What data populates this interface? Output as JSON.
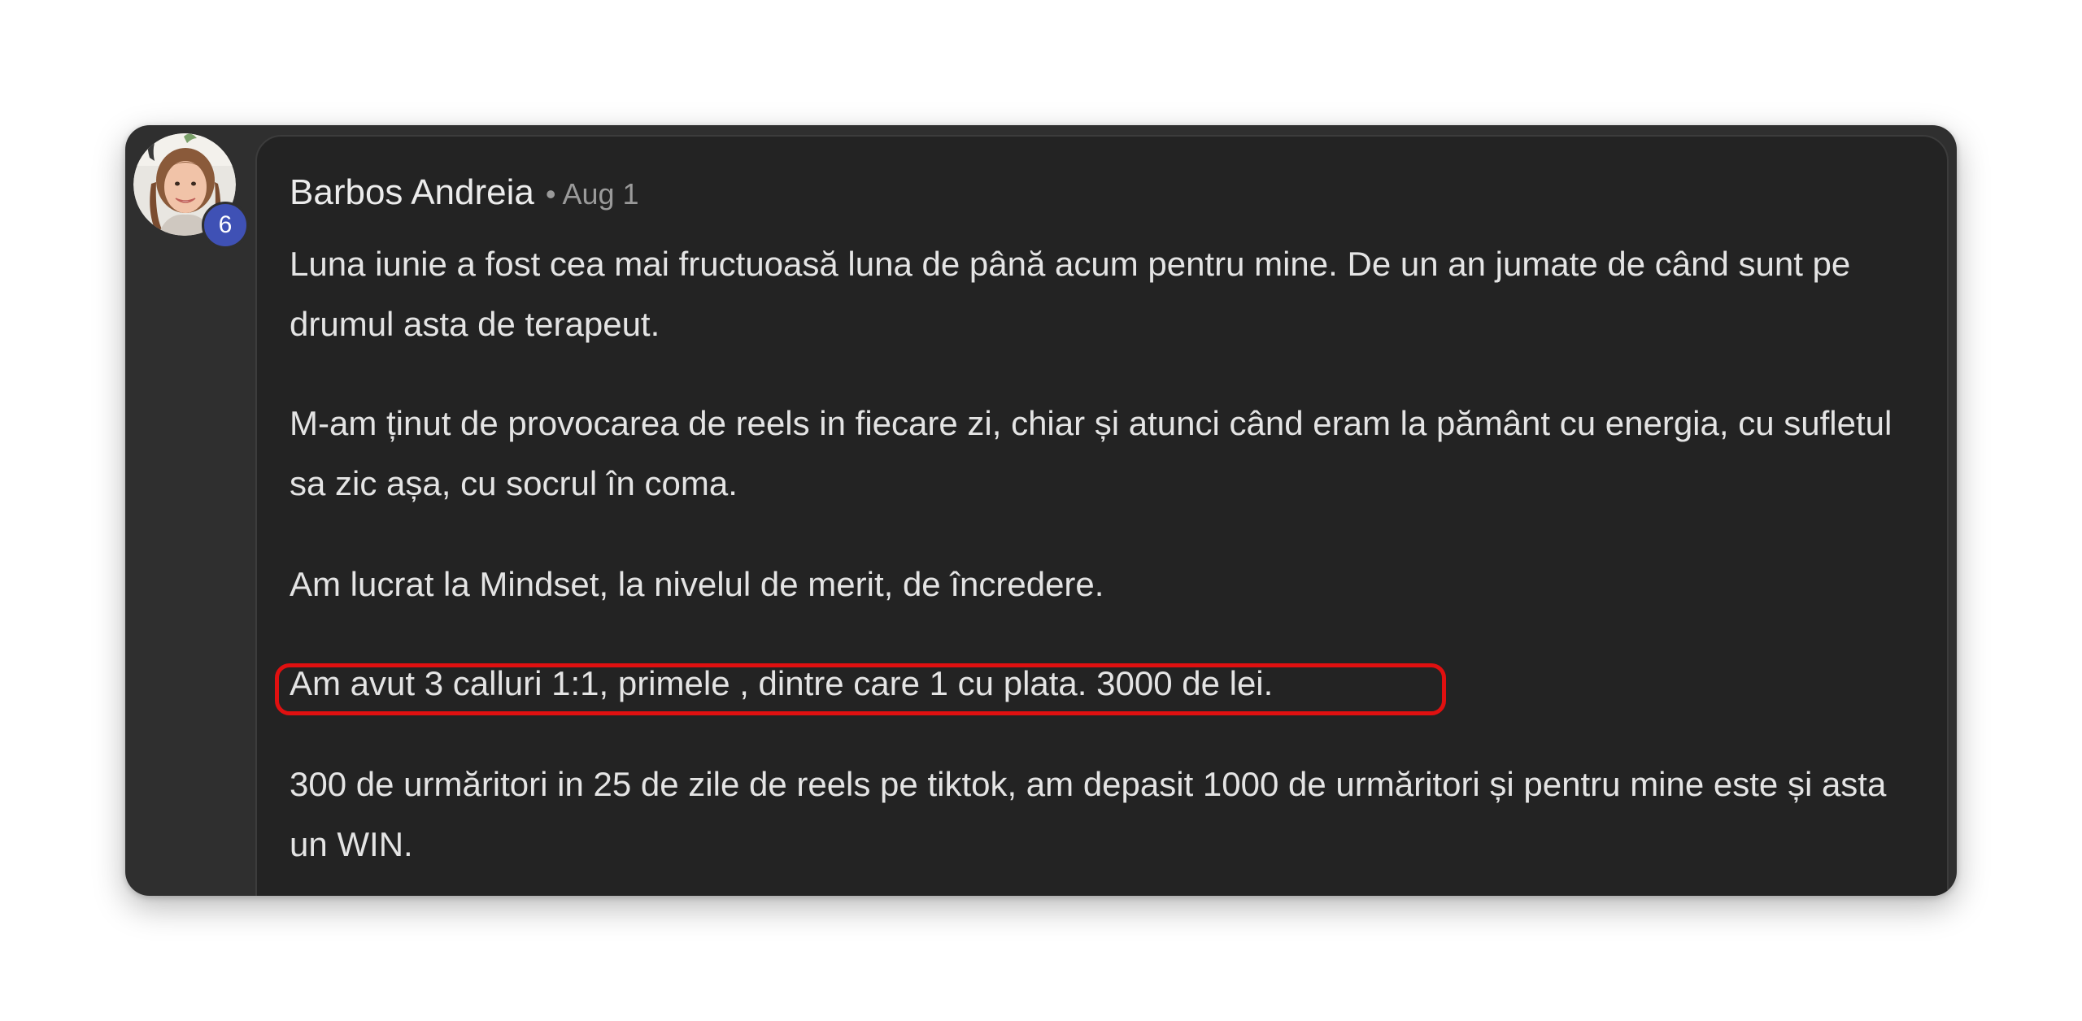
{
  "comment": {
    "author": "Barbos Andreia",
    "separator": "•",
    "date": "Aug 1",
    "level": "6",
    "paragraphs": [
      "Luna iunie a fost cea mai fructuoasă luna de până acum pentru mine. De un an jumate de când sunt pe drumul asta de terapeut.",
      "M-am ținut de provocarea de reels in fiecare zi, chiar și atunci când eram la pământ cu energia, cu sufletul sa zic așa, cu socrul în coma.",
      "Am lucrat la Mindset, la nivelul de merit, de încredere.",
      "Am avut 3 calluri 1:1, primele , dintre care 1 cu plata. 3000 de lei.",
      "300 de urmăritori in 25 de zile de reels pe tiktok, am depasit 1000 de urmăritori și pentru mine este și asta un WIN."
    ]
  },
  "colors": {
    "card_background": "#2f2f2f",
    "bubble_background": "#232323",
    "text": "#e4e4e4",
    "meta_text": "#9a9a9a",
    "level_badge": "#3f51b5",
    "highlight_border": "#e01010"
  },
  "icons": {
    "avatar": "user-avatar-photo"
  }
}
